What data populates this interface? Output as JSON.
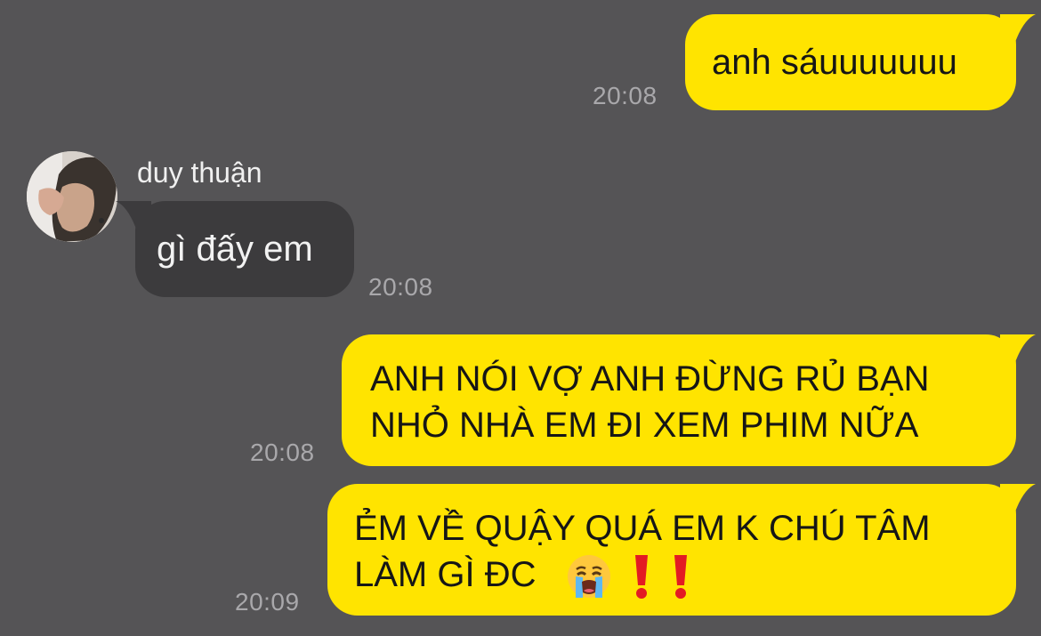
{
  "conversation": {
    "messages": [
      {
        "direction": "outgoing",
        "text": "anh sáuuuuuuu",
        "time": "20:08"
      },
      {
        "direction": "incoming",
        "sender": "duy thuận",
        "text": "gì đấy em",
        "time": "20:08"
      },
      {
        "direction": "outgoing",
        "text": "ANH NÓI VỢ ANH ĐỪNG RỦ BẠN\nNHỎ NHÀ EM ĐI XEM PHIM NỮA",
        "time": "20:08"
      },
      {
        "direction": "outgoing",
        "text": "ẺM VỀ QUẬY QUÁ EM K CHÚ TÂM\nLÀM GÌ ĐC",
        "emojis": [
          "crying-face",
          "exclamation-mark",
          "exclamation-mark"
        ],
        "time": "20:09"
      }
    ]
  },
  "colors": {
    "background": "#555456",
    "outgoing_bubble": "#ffe400",
    "incoming_bubble": "#3c3b3d",
    "timestamp": "#a9a8ab"
  }
}
